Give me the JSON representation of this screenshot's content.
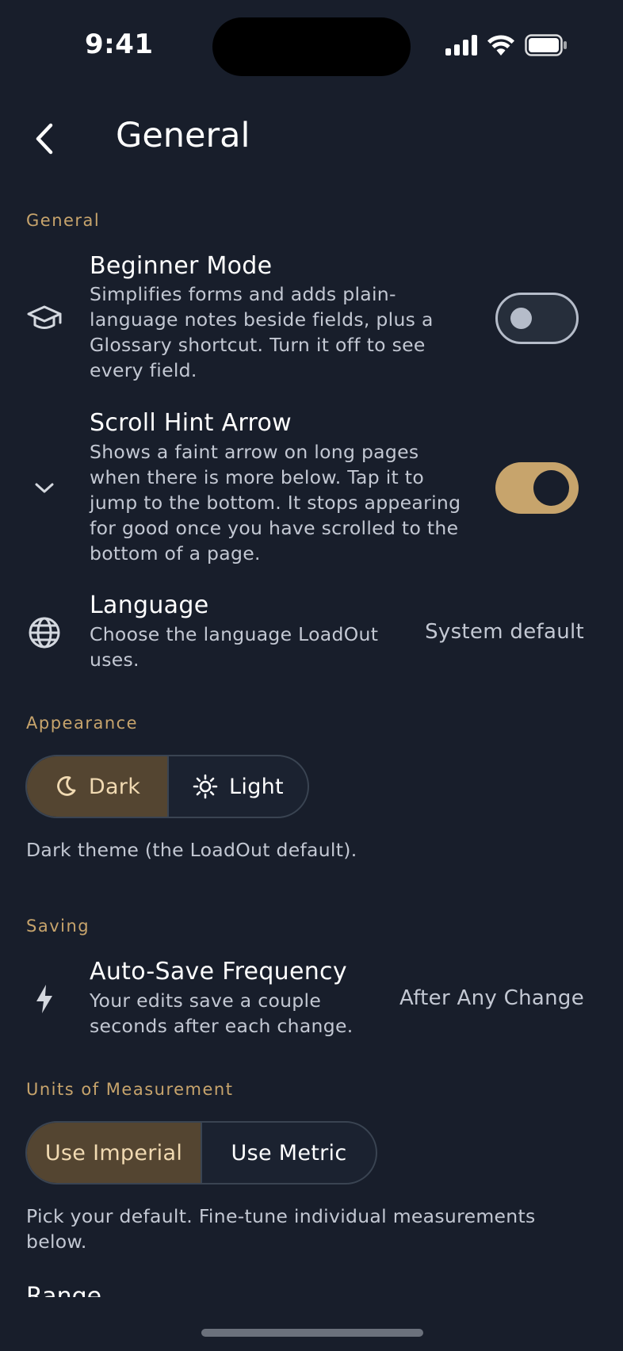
{
  "status": {
    "time": "9:41"
  },
  "header": {
    "title": "General"
  },
  "sections": {
    "general": "General",
    "appearance": "Appearance",
    "saving": "Saving",
    "units": "Units of Measurement"
  },
  "settings": {
    "beginner_mode": {
      "title": "Beginner Mode",
      "description": "Simplifies forms and adds plain-language notes beside fields, plus a Glossary shortcut. Turn it off to see every field.",
      "enabled": false
    },
    "scroll_hint": {
      "title": "Scroll Hint Arrow",
      "description": "Shows a faint arrow on long pages when there is more below. Tap it to jump to the bottom. It stops appearing for good once you have scrolled to the bottom of a page.",
      "enabled": true
    },
    "language": {
      "title": "Language",
      "description": "Choose the language LoadOut uses.",
      "value": "System default"
    },
    "auto_save": {
      "title": "Auto-Save Frequency",
      "description": "Your edits save a couple seconds after each change.",
      "value": "After Any Change"
    }
  },
  "appearance": {
    "options": [
      "Dark",
      "Light"
    ],
    "selected": "Dark",
    "caption": "Dark theme (the LoadOut default)."
  },
  "units": {
    "options": [
      "Use Imperial",
      "Use Metric"
    ],
    "selected": "Use Imperial",
    "caption": "Pick your default. Fine-tune individual measurements below."
  },
  "next_item": {
    "title": "Range"
  },
  "colors": {
    "accent": "#c7a46c",
    "background": "#181e2b",
    "selected_segment": "#544531"
  }
}
